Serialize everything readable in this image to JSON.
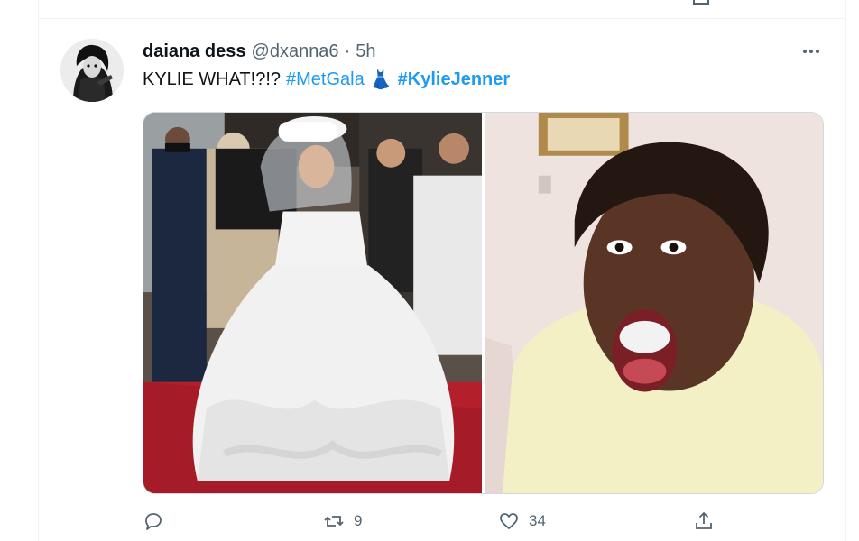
{
  "tweet": {
    "author": {
      "display_name": "daiana dess",
      "handle": "@dxanna6",
      "separator": "·",
      "time": "5h"
    },
    "text": {
      "prefix": "KYLIE WHAT!?!?",
      "hashtag_1": "#MetGala",
      "emoji": "👗",
      "hashtag_2": "#KylieJenner"
    },
    "more_icon": "more-horizontal-icon"
  },
  "actions": {
    "reply": {
      "icon": "reply-icon",
      "count": ""
    },
    "retweet": {
      "icon": "retweet-icon",
      "count": "9"
    },
    "like": {
      "icon": "heart-icon",
      "count": "34"
    },
    "share": {
      "icon": "share-icon",
      "count": ""
    }
  },
  "colors": {
    "accent": "#1d9bf0",
    "secondary_text": "#536471",
    "primary_text": "#0f1419",
    "border": "#cfd9de"
  }
}
